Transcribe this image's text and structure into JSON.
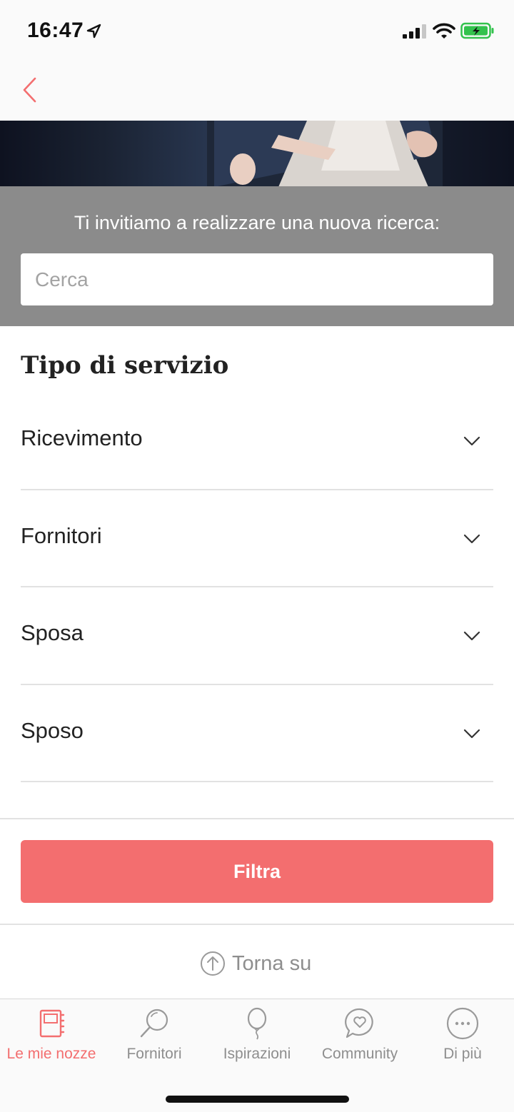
{
  "status_bar": {
    "time": "16:47",
    "icons": [
      "location-arrow-icon",
      "cellular-signal-icon",
      "wifi-icon",
      "battery-charging-icon"
    ],
    "battery_color": "#33c24d"
  },
  "nav": {
    "back_icon": "chevron-left-icon"
  },
  "search": {
    "prompt": "Ti invitiamo a realizzare una nuova ricerca:",
    "placeholder": "Cerca",
    "value": ""
  },
  "filters": {
    "title": "Tipo di servizio",
    "items": [
      {
        "label": "Ricevimento"
      },
      {
        "label": "Fornitori"
      },
      {
        "label": "Sposa"
      },
      {
        "label": "Sposo"
      }
    ],
    "button_label": "Filtra"
  },
  "back_to_top": {
    "label": "Torna su",
    "icon": "arrow-up-circle-icon"
  },
  "tabbar": {
    "active": "Le mie nozze",
    "tabs": [
      {
        "label": "Le mie nozze",
        "icon": "notebook-icon"
      },
      {
        "label": "Fornitori",
        "icon": "magnifier-icon"
      },
      {
        "label": "Ispirazioni",
        "icon": "balloon-icon"
      },
      {
        "label": "Community",
        "icon": "chat-heart-icon"
      },
      {
        "label": "Di più",
        "icon": "more-dots-icon"
      }
    ]
  },
  "colors": {
    "accent": "#f36e6f",
    "search_panel": "#8b8b8b",
    "inactive_tab": "#8e8e8e"
  }
}
